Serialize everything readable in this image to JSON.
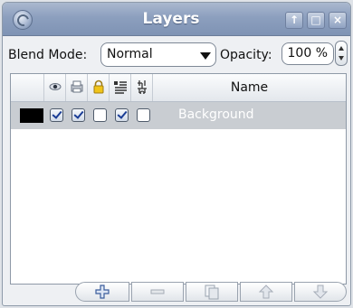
{
  "window": {
    "title": "Layers",
    "buttons": [
      "↑",
      "□",
      "×"
    ]
  },
  "blend": {
    "label": "Blend Mode:",
    "value": "Normal"
  },
  "opacity": {
    "label": "Opacity:",
    "value": "100 %"
  },
  "columns": {
    "icons": [
      "eye-icon",
      "printer-icon",
      "lock-icon",
      "text-lines-icon",
      "chain-link-icon"
    ],
    "name": "Name"
  },
  "layers": [
    {
      "name": "Background",
      "color": "#000000",
      "visible": true,
      "printable": true,
      "locked": false,
      "text_flag": true,
      "linked": false
    }
  ],
  "toolbar": {
    "buttons": [
      "add-layer",
      "remove-layer",
      "duplicate-layer",
      "move-up",
      "move-down"
    ]
  }
}
